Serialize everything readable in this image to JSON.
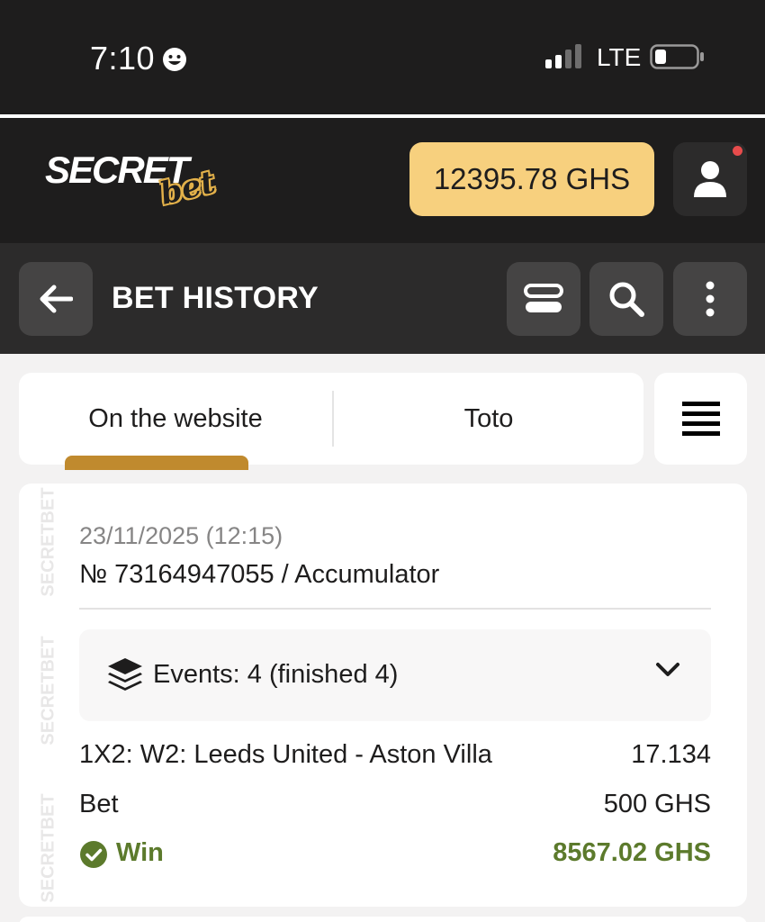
{
  "status_bar": {
    "time": "7:10",
    "network": "LTE"
  },
  "header": {
    "logo_main": "SECRET",
    "logo_sub": "bet",
    "balance": "12395.78 GHS",
    "colors": {
      "balance_bg": "#f7d07e",
      "header_bg": "#1e1d1d",
      "notification": "#e74c4c"
    }
  },
  "subheader": {
    "title": "BET HISTORY",
    "icons": [
      "arrow-left-icon",
      "layout-toggle-icon",
      "search-icon",
      "more-vertical-icon"
    ]
  },
  "tabs": {
    "items": [
      {
        "label": "On the website",
        "active": true
      },
      {
        "label": "Toto",
        "active": false
      }
    ],
    "active_color": "#c08a2e"
  },
  "bet": {
    "date": "23/11/2025 (12:15)",
    "id_line": "№ 73164947055 / Accumulator",
    "events_label": "Events: 4 (finished 4)",
    "market_label": "1X2: W2: Leeds United - Aston Villa",
    "odds": "17.134",
    "bet_label": "Bet",
    "bet_amount": "500 GHS",
    "result_label": "Win",
    "win_amount": "8567.02 GHS",
    "win_color": "#5c7a2c",
    "watermark": "SECRETBET"
  }
}
